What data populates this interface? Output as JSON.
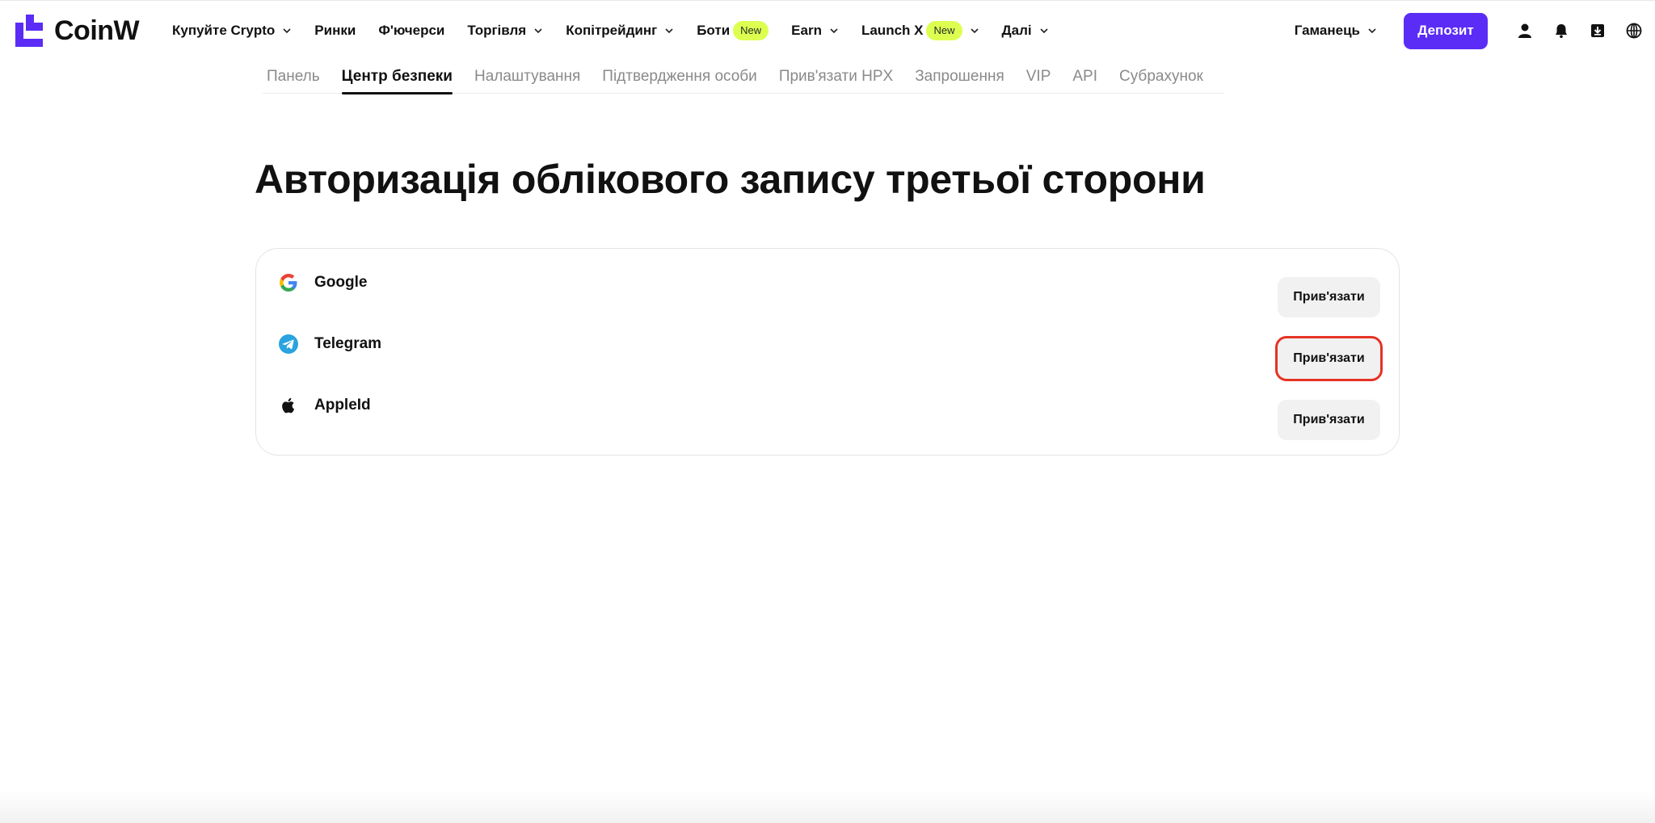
{
  "brand": {
    "name": "CoinW",
    "accent": "#5b2cf5",
    "badge_color": "#dcff50"
  },
  "nav": {
    "items": [
      {
        "label": "Купуйте Crypto",
        "has_chevron": true,
        "badge": ""
      },
      {
        "label": "Ринки",
        "has_chevron": false,
        "badge": ""
      },
      {
        "label": "Ф'ючерси",
        "has_chevron": false,
        "badge": ""
      },
      {
        "label": "Торгівля",
        "has_chevron": true,
        "badge": ""
      },
      {
        "label": "Копітрейдинг",
        "has_chevron": true,
        "badge": ""
      },
      {
        "label": "Боти",
        "has_chevron": false,
        "badge": "New"
      },
      {
        "label": "Earn",
        "has_chevron": true,
        "badge": ""
      },
      {
        "label": "Launch X",
        "has_chevron": true,
        "badge": "New"
      },
      {
        "label": "Далі",
        "has_chevron": true,
        "badge": ""
      }
    ],
    "wallet_label": "Гаманець",
    "deposit_label": "Депозит",
    "icons": [
      "user-icon",
      "bell-icon",
      "download-icon",
      "globe-icon"
    ]
  },
  "subtabs": {
    "items": [
      "Панель",
      "Центр безпеки",
      "Налаштування",
      "Підтвердження особи",
      "Прив'язати HPX",
      "Запрошення",
      "VIP",
      "API",
      "Субрахунок"
    ],
    "active": "Центр безпеки"
  },
  "main": {
    "title": "Авторизація облікового запису третьої сторони",
    "accounts": [
      {
        "name": "Google",
        "icon": "google-icon",
        "button": "Прив'язати",
        "highlighted": false
      },
      {
        "name": "Telegram",
        "icon": "telegram-icon",
        "button": "Прив'язати",
        "highlighted": true
      },
      {
        "name": "AppleId",
        "icon": "apple-icon",
        "button": "Прив'язати",
        "highlighted": false
      }
    ],
    "highlight_color": "#e53323"
  }
}
